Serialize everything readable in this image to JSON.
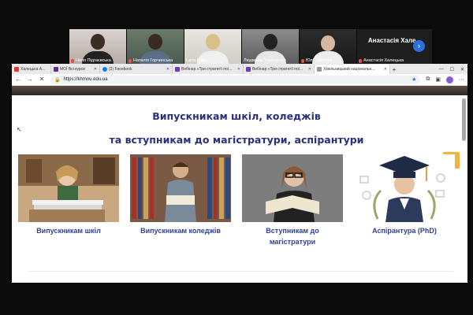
{
  "meeting": {
    "participants": [
      {
        "name": "Неля Підгаєвська"
      },
      {
        "name": "Наталія Горчинська"
      },
      {
        "name": "Lana Hulko"
      },
      {
        "name": "Людмила Терещенко"
      },
      {
        "name": "Юлія Кирпюк"
      },
      {
        "name": "Анастасія Халецька"
      }
    ],
    "featured_name": "Анастасія Хале..."
  },
  "browser": {
    "tabs": [
      {
        "label": "Халецька А..."
      },
      {
        "label": "МОЇ Всі курси"
      },
      {
        "label": "(2) Facebook"
      },
      {
        "label": "Вебінар «Три стратегії пої..."
      },
      {
        "label": "Вебінар «Три стратегії пої..."
      },
      {
        "label": "Хмельницький національн..."
      }
    ],
    "url": "https://khmnu.edu.ua"
  },
  "page": {
    "heading_line1": "Випускникам шкіл, коледжів",
    "heading_line2": "та вступникам до магістратури, аспірантури",
    "cards": [
      {
        "label": "Випускникам шкіл"
      },
      {
        "label": "Випускникам коледжів"
      },
      {
        "label": "Вступникам до магістратури"
      },
      {
        "label": "Аспірантура (PhD)"
      }
    ]
  },
  "colors": {
    "heading": "#2a2f7e",
    "card_label": "#2f3fa0",
    "accessibility_button": "#f2b53a",
    "active_speaker": "#5fd28a"
  },
  "icons": {
    "accessibility": "accessibility-icon",
    "next": "chevron-right-icon"
  }
}
